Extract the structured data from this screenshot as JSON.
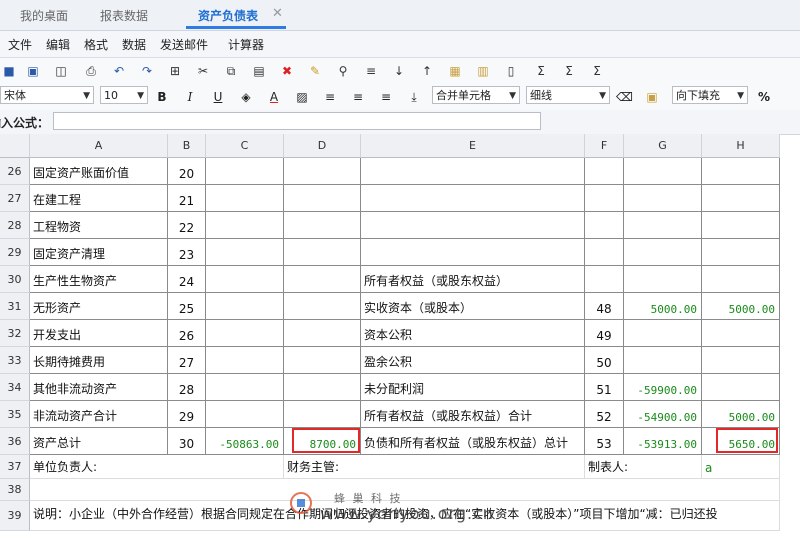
{
  "tabs": [
    {
      "label": "我的桌面",
      "active": false
    },
    {
      "label": "报表数据",
      "active": false
    },
    {
      "label": "资产负债表",
      "active": true
    }
  ],
  "tab_close": "✕",
  "menu": [
    "文件",
    "编辑",
    "格式",
    "数据",
    "发送邮件",
    "计算器"
  ],
  "toolbar": {
    "font": "宋体",
    "size": "10",
    "bold": "B",
    "italic": "I",
    "underline": "U",
    "font_color": "A",
    "merge": "合并单元格",
    "border": "细线",
    "fill": "向下填充",
    "percent": "%"
  },
  "formula": {
    "label": "输入公式：",
    "value": ""
  },
  "columns": [
    "A",
    "B",
    "C",
    "D",
    "E",
    "F",
    "G",
    "H"
  ],
  "rows": [
    {
      "n": "26",
      "a": "固定资产账面价值",
      "b": "20",
      "c": "",
      "d": "",
      "e": "",
      "f": "",
      "g": "",
      "h": ""
    },
    {
      "n": "27",
      "a": "在建工程",
      "b": "21",
      "c": "",
      "d": "",
      "e": "",
      "f": "",
      "g": "",
      "h": ""
    },
    {
      "n": "28",
      "a": "工程物资",
      "b": "22",
      "c": "",
      "d": "",
      "e": "",
      "f": "",
      "g": "",
      "h": ""
    },
    {
      "n": "29",
      "a": "固定资产清理",
      "b": "23",
      "c": "",
      "d": "",
      "e": "",
      "f": "",
      "g": "",
      "h": ""
    },
    {
      "n": "30",
      "a": "生产性生物资产",
      "b": "24",
      "c": "",
      "d": "",
      "e": "所有者权益（或股东权益）",
      "f": "",
      "g": "",
      "h": ""
    },
    {
      "n": "31",
      "a": "无形资产",
      "b": "25",
      "c": "",
      "d": "",
      "e": "实收资本（或股本）",
      "f": "48",
      "g": "5000.00",
      "h": "5000.00"
    },
    {
      "n": "32",
      "a": "开发支出",
      "b": "26",
      "c": "",
      "d": "",
      "e": "资本公积",
      "f": "49",
      "g": "",
      "h": ""
    },
    {
      "n": "33",
      "a": "长期待摊费用",
      "b": "27",
      "c": "",
      "d": "",
      "e": "盈余公积",
      "f": "50",
      "g": "",
      "h": ""
    },
    {
      "n": "34",
      "a": "其他非流动资产",
      "b": "28",
      "c": "",
      "d": "",
      "e": "未分配利润",
      "f": "51",
      "g": "-59900.00",
      "h": ""
    },
    {
      "n": "35",
      "a": "非流动资产合计",
      "b": "29",
      "c": "",
      "d": "",
      "e": "所有者权益（或股东权益）合计",
      "f": "52",
      "g": "-54900.00",
      "h": "5000.00"
    },
    {
      "n": "36",
      "a": "资产总计",
      "b": "30",
      "c": "-50863.00",
      "d": "8700.00",
      "e": "负债和所有者权益（或股东权益）总计",
      "f": "53",
      "g": "-53913.00",
      "h": "5650.00"
    }
  ],
  "row37": {
    "n": "37",
    "a": "单位负责人:",
    "d": "财务主管:",
    "f": "制表人:",
    "g": "a"
  },
  "row38": {
    "n": "38"
  },
  "row39": {
    "n": "39",
    "text": "说明：小企业（中外合作经营）根据合同规定在合作期间归还投资者的投资，应在“实收资本（或股本）”项目下增加“减：已归还投"
  },
  "watermark": {
    "cn": "蜂 巢 科 技",
    "url": "www.yonyou.org.cn"
  }
}
